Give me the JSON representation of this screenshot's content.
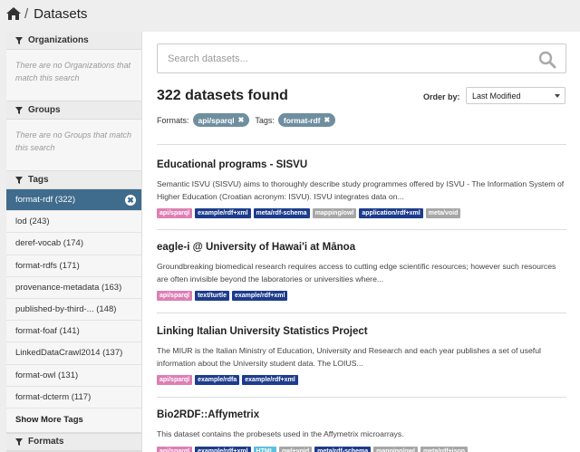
{
  "breadcrumb": {
    "home_icon": "home-icon",
    "separator": "/",
    "current": "Datasets"
  },
  "sidebar": {
    "organizations": {
      "title": "Organizations",
      "empty": "There are no Organizations that match this search"
    },
    "groups": {
      "title": "Groups",
      "empty": "There are no Groups that match this search"
    },
    "tags": {
      "title": "Tags",
      "items": [
        {
          "label": "format-rdf (322)",
          "active": true
        },
        {
          "label": "lod (243)"
        },
        {
          "label": "deref-vocab (174)"
        },
        {
          "label": "format-rdfs (171)"
        },
        {
          "label": "provenance-metadata (163)"
        },
        {
          "label": "published-by-third-... (148)"
        },
        {
          "label": "format-foaf (141)"
        },
        {
          "label": "LinkedDataCrawl2014 (137)"
        },
        {
          "label": "format-owl (131)"
        },
        {
          "label": "format-dcterm (117)"
        }
      ],
      "show_more": "Show More Tags",
      "remove_symbol": "✖"
    },
    "formats": {
      "title": "Formats"
    }
  },
  "main": {
    "search_placeholder": "Search datasets...",
    "count": "322 datasets found",
    "order_label": "Order by:",
    "order_value": "Last Modified",
    "filters": {
      "formats_label": "Formats:",
      "format_pill": "api/sparql",
      "tags_label": "Tags:",
      "tag_pill": "format-rdf",
      "remove_symbol": "✖"
    },
    "datasets": [
      {
        "title": "Educational programs - SISVU",
        "desc": "Semantic ISVU (SISVU) aims to thoroughly describe study programmes offered by ISVU - The Information System of Higher Education (Croatian acronym: ISVU). ISVU integrates data on...",
        "formats": [
          {
            "label": "api/sparql",
            "color": "#dd7fb4"
          },
          {
            "label": "example/rdf+xml",
            "color": "#1e3c8c"
          },
          {
            "label": "meta/rdf-schema",
            "color": "#1e3c8c"
          },
          {
            "label": "mapping/owl",
            "color": "#a7a7a7"
          },
          {
            "label": "application/rdf+xml",
            "color": "#1e3c8c"
          },
          {
            "label": "meta/void",
            "color": "#a7a7a7"
          }
        ]
      },
      {
        "title": "eagle-i @ University of Hawai'i at Mānoa",
        "desc": "Groundbreaking biomedical research requires access to cutting edge scientific resources; however such resources are often invisible beyond the laboratories or universities where...",
        "formats": [
          {
            "label": "api/sparql",
            "color": "#dd7fb4"
          },
          {
            "label": "text/turtle",
            "color": "#1e3c8c"
          },
          {
            "label": "example/rdf+xml",
            "color": "#1e3c8c"
          }
        ]
      },
      {
        "title": "Linking Italian University Statistics Project",
        "desc": "The MIUR is the Italian Ministry of Education, University and Research and each year publishes a set of useful information about the University student data. The LOIUS...",
        "formats": [
          {
            "label": "api/sparql",
            "color": "#dd7fb4"
          },
          {
            "label": "example/rdfa",
            "color": "#1e3c8c"
          },
          {
            "label": "example/rdf+xml",
            "color": "#1e3c8c"
          }
        ]
      },
      {
        "title": "Bio2RDF::Affymetrix",
        "desc": "This dataset contains the probesets used in the Affymetrix microarrays.",
        "formats": [
          {
            "label": "api/sparql",
            "color": "#dd7fb4"
          },
          {
            "label": "example/rdf+xml",
            "color": "#1e3c8c"
          },
          {
            "label": "HTML",
            "color": "#5bc0de"
          },
          {
            "label": "owl+void",
            "color": "#a7a7a7"
          },
          {
            "label": "meta/rdf-schema",
            "color": "#1e3c8c"
          },
          {
            "label": "mapping/owl",
            "color": "#a7a7a7"
          },
          {
            "label": "meta/rdf+json",
            "color": "#a7a7a7"
          }
        ]
      }
    ]
  }
}
